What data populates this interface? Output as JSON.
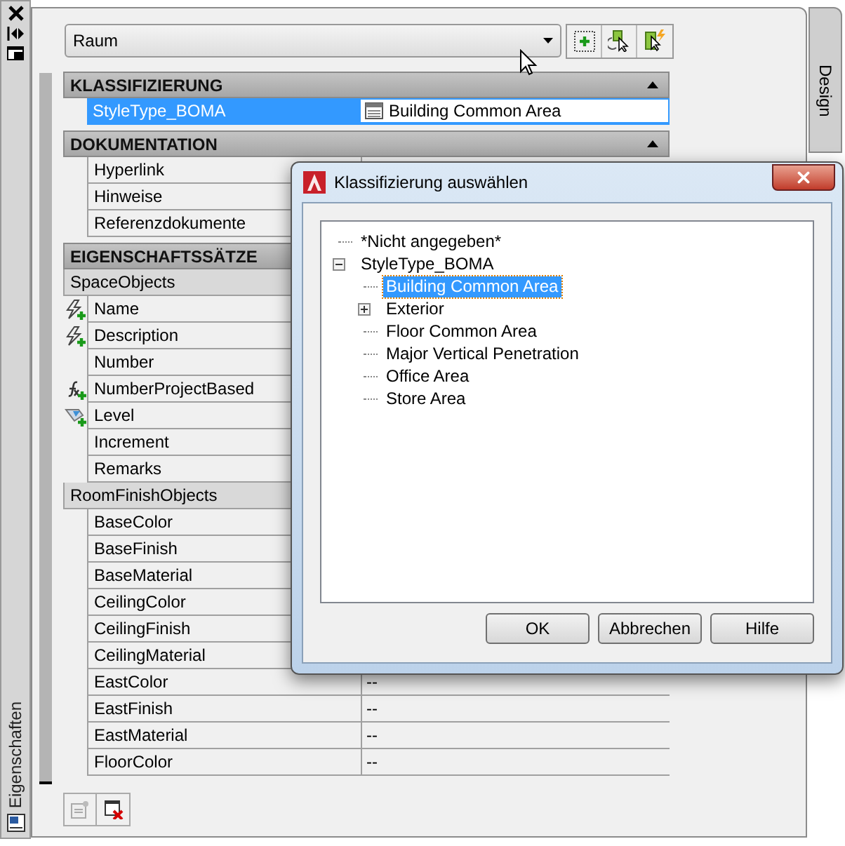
{
  "palette": {
    "title": "Eigenschaften",
    "side_tab": "Design",
    "object_type": "Raum",
    "sections": [
      {
        "title": "KLASSIFIZIERUNG",
        "expanded": true,
        "groups": [
          {
            "rows": [
              {
                "label": "StyleType_BOMA",
                "value": "Building Common Area",
                "kind": "classification",
                "selected": true
              }
            ]
          }
        ]
      },
      {
        "title": "DOKUMENTATION",
        "expanded": true,
        "groups": [
          {
            "rows": [
              {
                "label": "Hyperlink",
                "selected": false
              },
              {
                "label": "Hinweise",
                "selected": false
              },
              {
                "label": "Referenzdokumente",
                "selected": false
              }
            ]
          }
        ]
      },
      {
        "title": "EIGENSCHAFTSSÄTZE",
        "expanded": true,
        "groups": [
          {
            "title": "SpaceObjects",
            "rows": [
              {
                "label": "Name",
                "kind": "lightning",
                "selected": false
              },
              {
                "label": "Description",
                "kind": "lightning",
                "selected": false
              },
              {
                "label": "Number",
                "selected": false
              },
              {
                "label": "NumberProjectBased",
                "kind": "formula",
                "selected": false
              },
              {
                "label": "Level",
                "kind": "location",
                "selected": false
              },
              {
                "label": "Increment",
                "selected": false
              },
              {
                "label": "Remarks",
                "selected": false
              }
            ]
          },
          {
            "title": "RoomFinishObjects",
            "rows": [
              {
                "label": "BaseColor",
                "selected": false
              },
              {
                "label": "BaseFinish",
                "selected": false
              },
              {
                "label": "BaseMaterial",
                "selected": false
              },
              {
                "label": "CeilingColor",
                "selected": false
              },
              {
                "label": "CeilingFinish",
                "selected": false
              },
              {
                "label": "CeilingMaterial",
                "selected": false
              },
              {
                "label": "EastColor",
                "value": "--",
                "selected": false
              },
              {
                "label": "EastFinish",
                "value": "--",
                "selected": false
              },
              {
                "label": "EastMaterial",
                "value": "--",
                "selected": false
              },
              {
                "label": "FloorColor",
                "value": "--",
                "selected": false
              }
            ]
          }
        ]
      }
    ]
  },
  "dialog": {
    "title": "Klassifizierung auswählen",
    "tree": [
      {
        "label": "*Nicht angegeben*",
        "selected": false
      },
      {
        "label": "StyleType_BOMA",
        "selected": false,
        "expanded": true,
        "children": [
          {
            "label": "Building Common Area",
            "selected": true
          },
          {
            "label": "Exterior",
            "selected": false,
            "expanded": false
          },
          {
            "label": "Floor Common Area",
            "selected": false
          },
          {
            "label": "Major Vertical Penetration",
            "selected": false
          },
          {
            "label": "Office Area",
            "selected": false
          },
          {
            "label": "Store Area",
            "selected": false
          }
        ]
      }
    ],
    "buttons": [
      "OK",
      "Abbrechen",
      "Hilfe"
    ]
  }
}
